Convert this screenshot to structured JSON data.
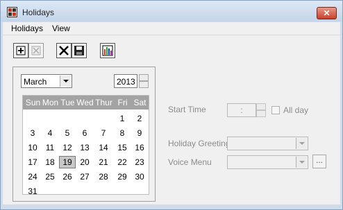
{
  "window": {
    "title": "Holidays",
    "close_label": "✕"
  },
  "menu": [
    "Holidays",
    "View"
  ],
  "toolbar": {
    "buttons": [
      {
        "name": "new-holiday-icon",
        "enabled": true
      },
      {
        "name": "disabled-edit-icon",
        "enabled": false
      },
      {
        "name": "delete-x-icon",
        "enabled": true
      },
      {
        "name": "save-disk-icon",
        "enabled": true
      },
      {
        "name": "report-chart-icon",
        "enabled": true
      }
    ]
  },
  "calendar": {
    "month": "March",
    "year": "2013",
    "weekdays": [
      "Sun",
      "Mon",
      "Tue",
      "Wed",
      "Thur",
      "Fri",
      "Sat"
    ],
    "weeks": [
      [
        "",
        "",
        "",
        "",
        "",
        "1",
        "2"
      ],
      [
        "3",
        "4",
        "5",
        "6",
        "7",
        "8",
        "9"
      ],
      [
        "10",
        "11",
        "12",
        "13",
        "14",
        "15",
        "16"
      ],
      [
        "17",
        "18",
        "19",
        "20",
        "21",
        "22",
        "23"
      ],
      [
        "24",
        "25",
        "26",
        "27",
        "28",
        "29",
        "30"
      ],
      [
        "31",
        "",
        "",
        "",
        "",
        "",
        ""
      ]
    ],
    "selected_day": "19"
  },
  "form": {
    "start_time_label": "Start Time",
    "start_time_value": ":",
    "all_day_label": "All day",
    "greeting_label": "Holiday Greeting",
    "greeting_value": "",
    "voice_menu_label": "Voice Menu",
    "voice_menu_value": "",
    "browse_label": "..."
  }
}
